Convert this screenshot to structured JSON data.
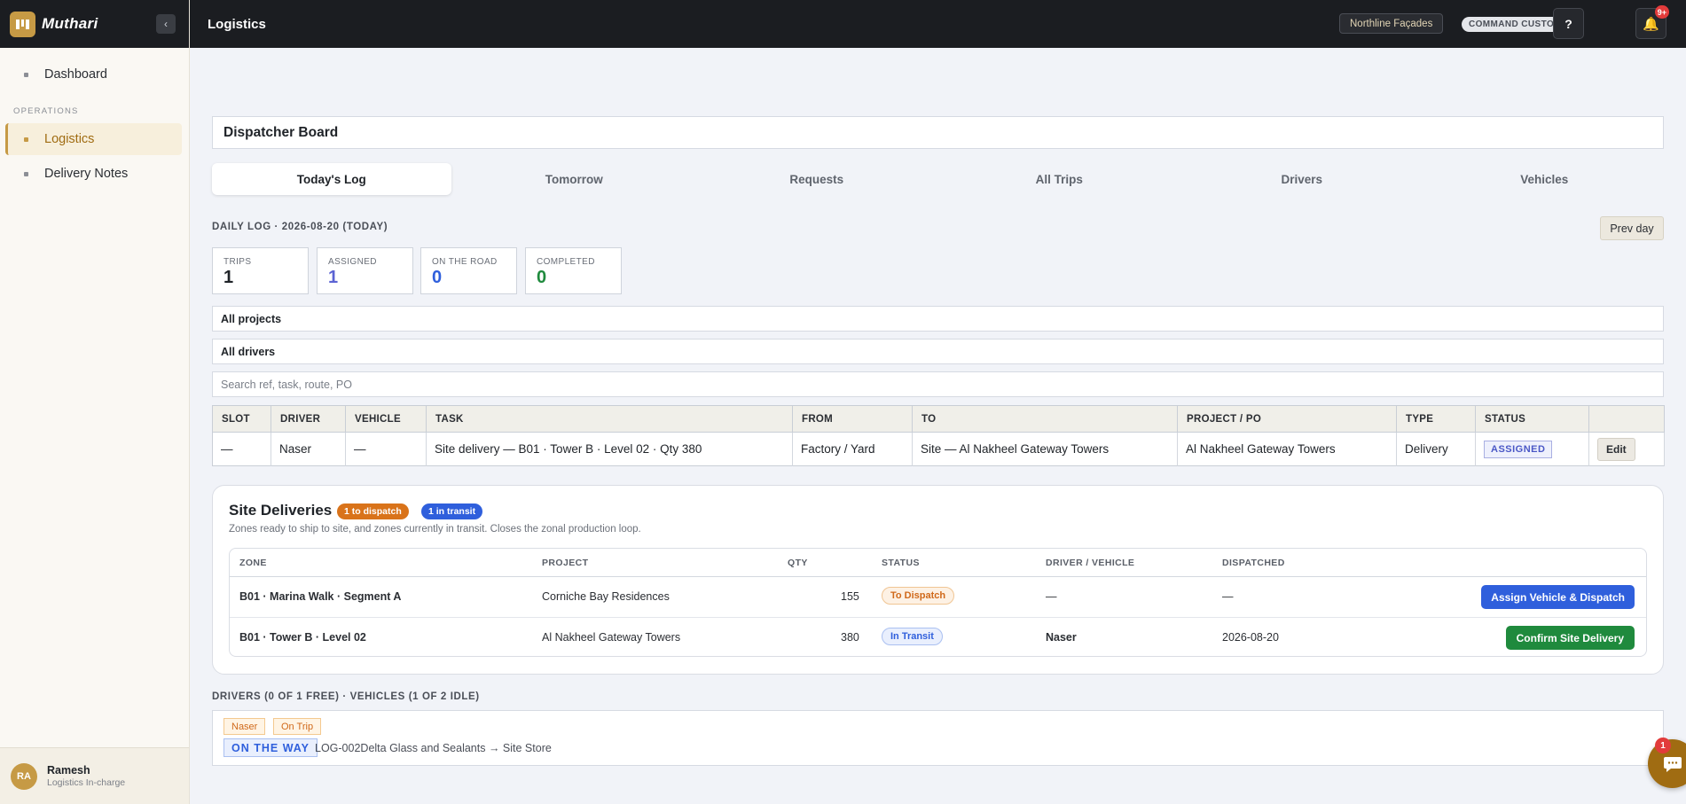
{
  "sidebar": {
    "brand": "Muthari",
    "collapse_icon": "‹",
    "items": [
      {
        "label": "Dashboard"
      },
      {
        "label": "Logistics"
      },
      {
        "label": "Delivery Notes"
      }
    ],
    "section_operations": "OPERATIONS",
    "user": {
      "initials": "RA",
      "name": "Ramesh",
      "role": "Logistics In-charge"
    }
  },
  "header": {
    "title": "Logistics",
    "org": "Northline Façades",
    "mode": "COMMAND CUSTOM",
    "help_label": "?",
    "notif_badge": "9+"
  },
  "board": {
    "title": "Dispatcher Board",
    "tabs": [
      "Today's Log",
      "Tomorrow",
      "Requests",
      "All Trips",
      "Drivers",
      "Vehicles"
    ],
    "active_tab": "Today's Log",
    "daily_label": "DAILY LOG · 2026-08-20 (TODAY)",
    "prev_day_label": "Prev day",
    "stats": [
      {
        "label": "TRIPS",
        "value": "1",
        "color": "#1f2328"
      },
      {
        "label": "ASSIGNED",
        "value": "1",
        "color": "#5b63d3"
      },
      {
        "label": "ON THE ROAD",
        "value": "0",
        "color": "#2f5fdc"
      },
      {
        "label": "COMPLETED",
        "value": "0",
        "color": "#1f8a3d"
      }
    ],
    "filters": {
      "project": "All projects",
      "driver": "All drivers",
      "search_placeholder": "Search ref, task, route, PO"
    }
  },
  "trips_table": {
    "headers": [
      "SLOT",
      "DRIVER",
      "VEHICLE",
      "TASK",
      "FROM",
      "TO",
      "PROJECT / PO",
      "TYPE",
      "STATUS",
      ""
    ],
    "rows": [
      {
        "slot": "—",
        "driver": "Naser",
        "vehicle": "—",
        "task": "Site delivery — B01 · Tower B · Level 02 · Qty 380",
        "from": "Factory / Yard",
        "to": "Site — Al Nakheel Gateway Towers",
        "project": "Al Nakheel Gateway Towers",
        "type": "Delivery",
        "status": "ASSIGNED",
        "action": "Edit"
      }
    ]
  },
  "site_deliveries": {
    "title": "Site Deliveries",
    "pill_dispatch": "1 to dispatch",
    "pill_transit": "1 in transit",
    "subtitle": "Zones ready to ship to site, and zones currently in transit. Closes the zonal production loop.",
    "headers": {
      "zone": "ZONE",
      "project": "PROJECT",
      "qty": "QTY",
      "status": "STATUS",
      "driver": "DRIVER / VEHICLE",
      "dispatched": "DISPATCHED"
    },
    "rows": [
      {
        "zone": "B01 · Marina Walk · Segment A",
        "project": "Corniche Bay Residences",
        "qty": "155",
        "status": "To Dispatch",
        "driver": "—",
        "dispatched": "—",
        "action": "Assign Vehicle & Dispatch"
      },
      {
        "zone": "B01 · Tower B · Level 02",
        "project": "Al Nakheel Gateway Towers",
        "qty": "380",
        "status": "In Transit",
        "driver": "Naser",
        "dispatched": "2026-08-20",
        "action": "Confirm Site Delivery"
      }
    ]
  },
  "drivers_section": {
    "label": "DRIVERS (0 OF 1 FREE) · VEHICLES (1 OF 2 IDLE)",
    "driver_name": "Naser",
    "driver_status": "On Trip",
    "trip_state": "ON THE WAY",
    "trip_detail": "LOG-002Delta Glass and Sealants → Site Store"
  },
  "chat": {
    "badge": "1"
  }
}
